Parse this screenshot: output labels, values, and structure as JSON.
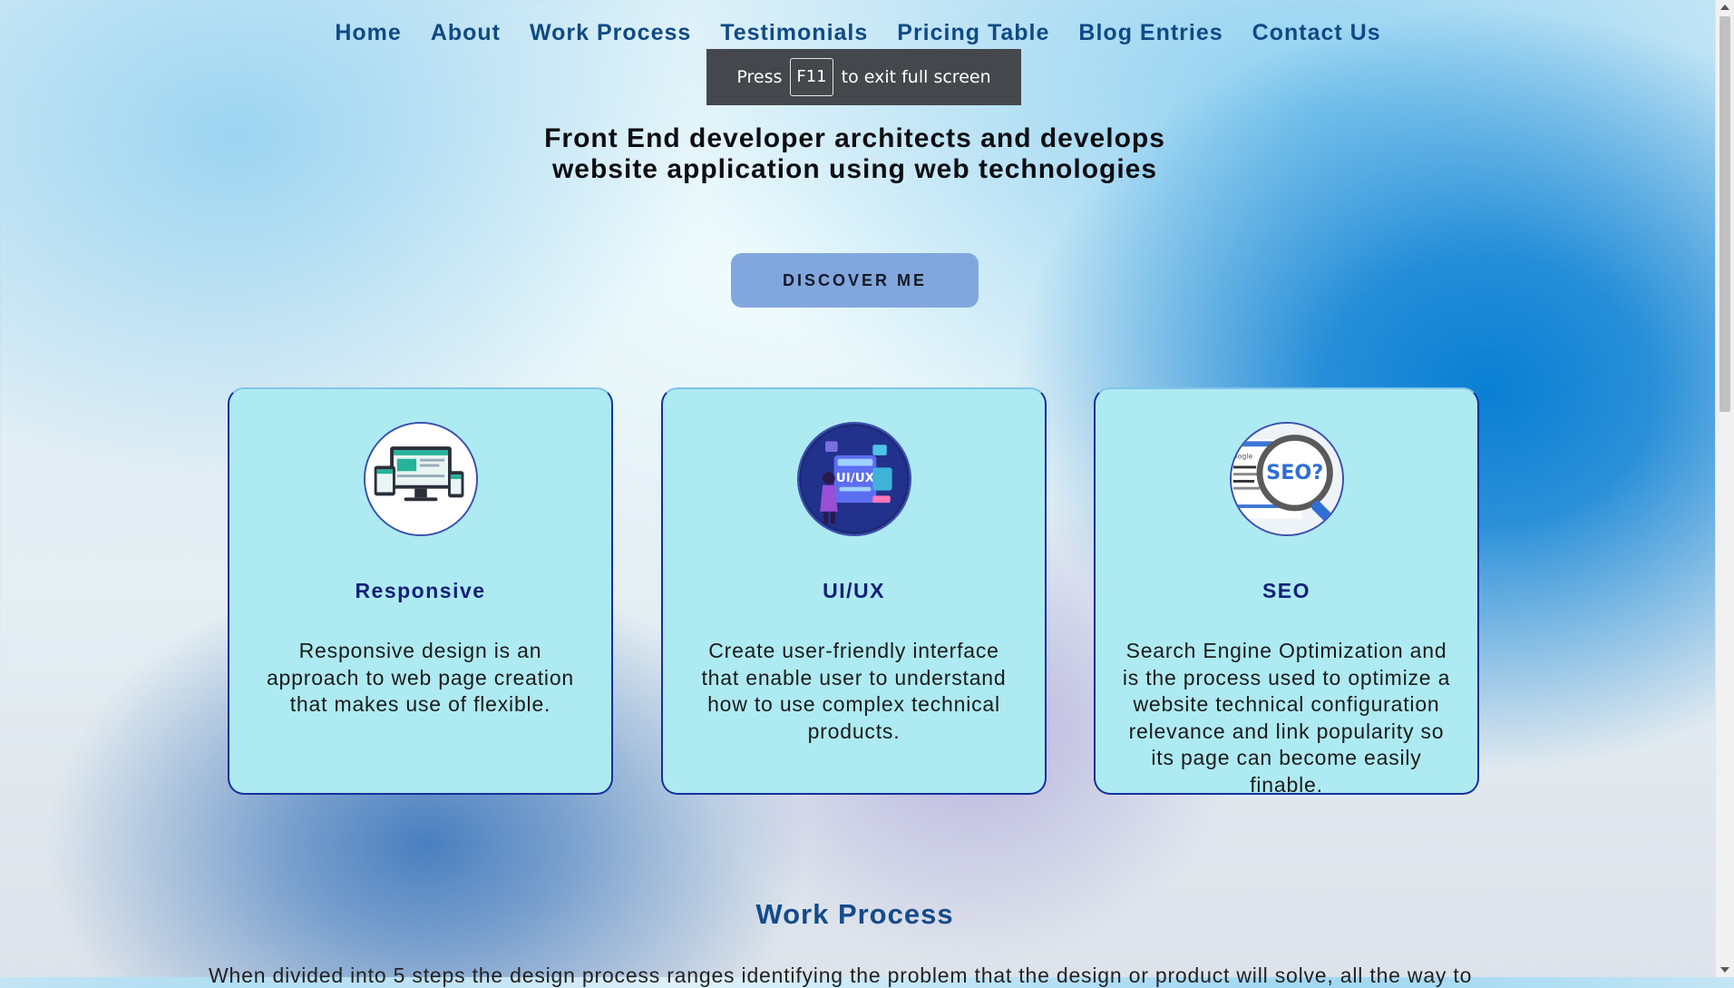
{
  "nav": {
    "items": [
      {
        "label": "Home"
      },
      {
        "label": "About"
      },
      {
        "label": "Work Process"
      },
      {
        "label": "Testimonials"
      },
      {
        "label": "Pricing Table"
      },
      {
        "label": "Blog Entries"
      },
      {
        "label": "Contact Us"
      }
    ]
  },
  "fullscreen_notice": {
    "press": "Press",
    "key": "F11",
    "suffix": "to exit full screen"
  },
  "hero": {
    "title": "Front End developer architects and develops website application using web technologies",
    "button": "DISCOVER ME"
  },
  "services": [
    {
      "icon": "responsive-devices-icon",
      "title": "Responsive",
      "text": "Responsive design is an approach to web page creation that makes use of flexible."
    },
    {
      "icon": "ui-ux-design-icon",
      "title": "UI/UX",
      "text": "Create user-friendly interface that enable user to understand how to use complex technical products."
    },
    {
      "icon": "seo-magnifier-icon",
      "title": "SEO",
      "text": "Search Engine Optimization and is the process used to optimize a website technical configuration relevance and link popularity so its page can become easily finable.",
      "icon_text": "SEO?",
      "icon_subtext": "oogle"
    }
  ],
  "work_process": {
    "title": "Work Process",
    "text": "When divided into 5 steps the design process ranges identifying the problem that the design or product will solve, all the way to"
  },
  "colors": {
    "nav": "#0f4a84",
    "button": "#82a7de",
    "card": "#aeeaf1",
    "card_border": "#152f9b",
    "card_title": "#14207a"
  }
}
